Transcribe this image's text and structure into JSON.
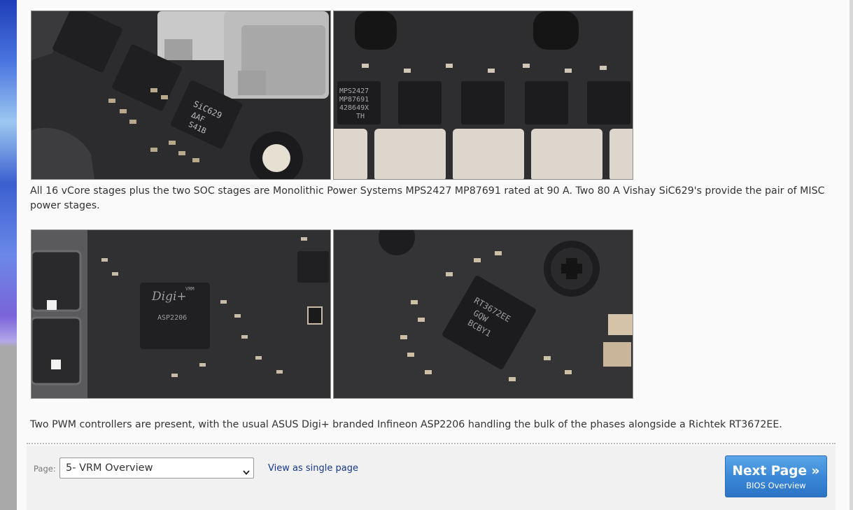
{
  "content": {
    "caption_1": "All 16 vCore stages plus the two SOC stages are Monolithic Power Systems MPS2427 MP87691 rated at 90 A. Two 80 A Vishay SiC629's provide the pair of MISC power stages.",
    "caption_2": "Two PWM controllers are present, with the usual ASUS Digi+ branded Infineon ASP2206 handling the bulk of the phases alongside a Richtek RT3672EE.",
    "photos": [
      {
        "chip_lines": [
          "SiC629",
          "ΔAF",
          "S41B"
        ]
      },
      {
        "chip_lines": [
          "MPS2427",
          "MP87691",
          "428649X",
          "TH"
        ]
      },
      {
        "chip_lines": [
          "Digi+",
          "ASP2206",
          "VRM"
        ]
      },
      {
        "chip_lines": [
          "RT3672EE",
          "GQW",
          "BCBY1"
        ]
      }
    ]
  },
  "footer": {
    "page_label": "Page:",
    "page_select_value": "5- VRM Overview",
    "single_page_link": "View as single page",
    "next_button_label": "Next Page »",
    "next_button_sub": "BIOS Overview"
  },
  "colors": {
    "link": "#14388c",
    "button_blue": "#3a86d6",
    "text": "#333333"
  }
}
